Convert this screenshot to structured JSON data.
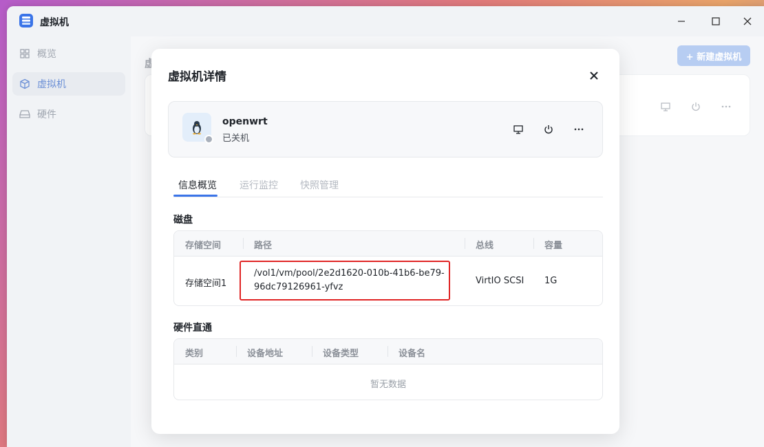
{
  "window": {
    "title": "虚拟机",
    "icon": "server-stack-icon"
  },
  "sidebar": {
    "items": [
      {
        "label": "概览",
        "icon": "grid-icon",
        "active": false
      },
      {
        "label": "虚拟机",
        "icon": "cube-icon",
        "active": true
      },
      {
        "label": "硬件",
        "icon": "drive-icon",
        "active": false
      }
    ]
  },
  "main": {
    "title": "虚",
    "new_button": "+ 新建虚拟机"
  },
  "modal": {
    "title": "虚拟机详情",
    "vm": {
      "name": "openwrt",
      "state": "已关机",
      "icon": "linux-penguin-icon"
    },
    "tabs": [
      {
        "label": "信息概览",
        "active": true
      },
      {
        "label": "运行监控",
        "active": false
      },
      {
        "label": "快照管理",
        "active": false
      }
    ],
    "disk": {
      "section_label": "磁盘",
      "headers": [
        "存储空间",
        "路径",
        "总线",
        "容量"
      ],
      "rows": [
        {
          "storage": "存储空间1",
          "path_line1": "/vol1/vm/pool/2e2d1620-010b-41b6-be79-",
          "path_line2": "96dc79126961-yfvz",
          "bus": "VirtIO SCSI",
          "capacity": "1G"
        }
      ]
    },
    "passthrough": {
      "section_label": "硬件直通",
      "headers": [
        "类别",
        "设备地址",
        "设备类型",
        "设备名"
      ],
      "empty_text": "暂无数据"
    }
  },
  "colors": {
    "accent": "#3a74e8",
    "highlight": "#e02424"
  }
}
